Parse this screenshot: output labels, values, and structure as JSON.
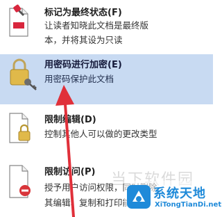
{
  "menu": {
    "final": {
      "title": "标记为最终状态(F)",
      "desc_line1": "让读者知晓此文档是最终版",
      "desc_line2": "本，并将其设为只读"
    },
    "encrypt": {
      "title": "用密码进行加密(E)",
      "desc_line1": "用密码保护此文档"
    },
    "restrict_edit": {
      "title": "限制编辑(D)",
      "desc_line1": "控制其他人可以做的更改类型"
    },
    "restrict_access": {
      "title": "限制访问(P)",
      "desc_line1": "授予用户访问权限，同时删除",
      "desc_line2": "其编辑、复制和打印能力"
    }
  },
  "watermark": {
    "site_top": "系统天地",
    "site_bottom": "XiTongTianDi.net",
    "overlay": "当下软件园"
  },
  "colors": {
    "highlight": "#c8daf2",
    "arrow": "#e0303a",
    "watermark": "#1f8ad9"
  }
}
